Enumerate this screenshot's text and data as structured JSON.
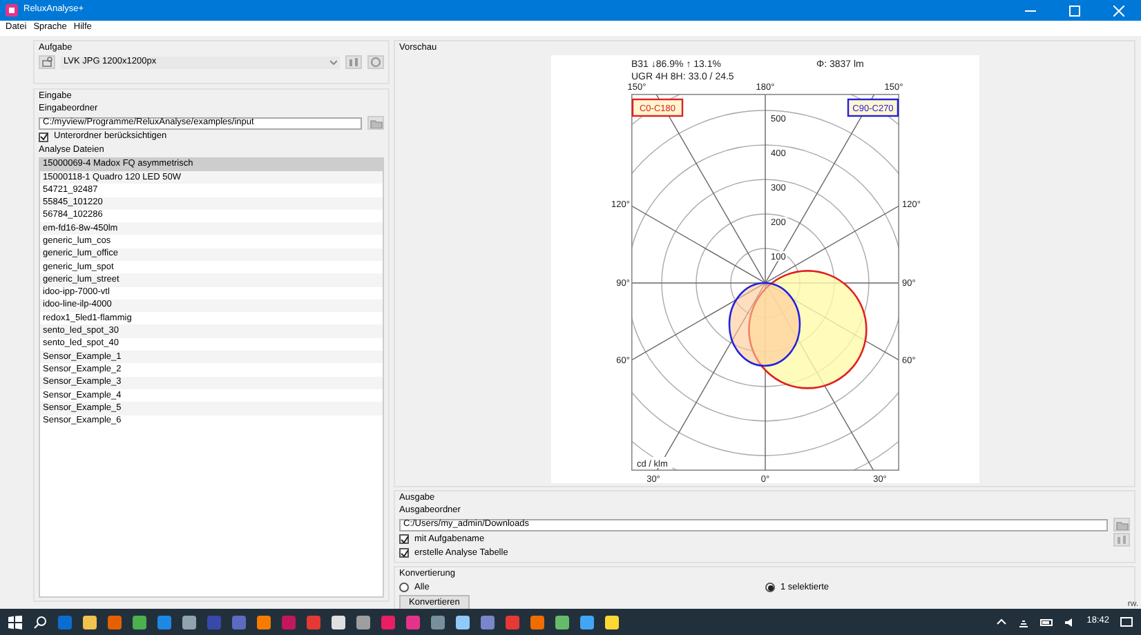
{
  "window": {
    "title": "ReluxAnalyse+"
  },
  "menu": [
    "Datei",
    "Sprache",
    "Hilfe"
  ],
  "task": {
    "heading": "Aufgabe",
    "value": "LVK JPG 1200x1200px"
  },
  "input": {
    "heading": "Eingabe",
    "folder_label": "Eingabeordner",
    "folder": "C:/myview/Programme/ReluxAnalyse/examples/input",
    "subfolders": {
      "label": "Unterordner berücksichtigen",
      "checked": true
    },
    "files_label": "Analyse Dateien",
    "files": [
      {
        "name": "15000069-4 Madox FQ asymmetrisch",
        "selected": true
      },
      {
        "name": "15000118-1 Quadro 120 LED 50W",
        "selected": false
      },
      {
        "name": "54721_92487",
        "selected": false
      },
      {
        "name": "55845_101220",
        "selected": false
      },
      {
        "name": "56784_102286",
        "selected": false
      },
      {
        "name": "em-fd16-8w-450lm",
        "selected": false
      },
      {
        "name": "generic_lum_cos",
        "selected": false
      },
      {
        "name": "generic_lum_office",
        "selected": false
      },
      {
        "name": "generic_lum_spot",
        "selected": false
      },
      {
        "name": "generic_lum_street",
        "selected": false
      },
      {
        "name": "idoo-ipp-7000-vtl",
        "selected": false
      },
      {
        "name": "idoo-line-ilp-4000",
        "selected": false
      },
      {
        "name": "redox1_5led1-flammig",
        "selected": false
      },
      {
        "name": "sento_led_spot_30",
        "selected": false
      },
      {
        "name": "sento_led_spot_40",
        "selected": false
      },
      {
        "name": "Sensor_Example_1",
        "selected": false
      },
      {
        "name": "Sensor_Example_2",
        "selected": false
      },
      {
        "name": "Sensor_Example_3",
        "selected": false
      },
      {
        "name": "Sensor_Example_4",
        "selected": false
      },
      {
        "name": "Sensor_Example_5",
        "selected": false
      },
      {
        "name": "Sensor_Example_6",
        "selected": false
      }
    ]
  },
  "preview": {
    "heading": "Vorschau",
    "diagram": {
      "summary": "B31 ↓86.9% ↑ 13.1%",
      "flux": "Φ: 3837 lm",
      "ugr": "UGR 4H 8H: 33.0 / 24.5",
      "top_labels": [
        "150°",
        "180°",
        "150°"
      ],
      "left_labels": [
        "120°",
        "90°",
        "60°"
      ],
      "right_labels": [
        "120°",
        "90°",
        "60°"
      ],
      "bottom_labels": [
        "30°",
        "0°",
        "30°"
      ],
      "ring_labels": [
        "500",
        "400",
        "300",
        "200",
        "100"
      ],
      "unit": "cd / klm",
      "legend": [
        {
          "label": "C0-C180",
          "color": "#e02020"
        },
        {
          "label": "C90-C270",
          "color": "#2020e0"
        }
      ]
    }
  },
  "output": {
    "heading": "Ausgabe",
    "folder_label": "Ausgabeordner",
    "folder": "C:/Users/my_admin/Downloads",
    "options": [
      {
        "label": "mit Aufgabename",
        "checked": true
      },
      {
        "label": "erstelle Analyse Tabelle",
        "checked": true
      }
    ]
  },
  "conversion": {
    "heading": "Konvertierung",
    "modes": [
      {
        "label": "Alle",
        "selected": false
      },
      {
        "label": "1 selektierte",
        "selected": true
      }
    ],
    "button": "Konvertieren"
  },
  "status": "rw.",
  "taskbar": {
    "clock": "18:42"
  }
}
